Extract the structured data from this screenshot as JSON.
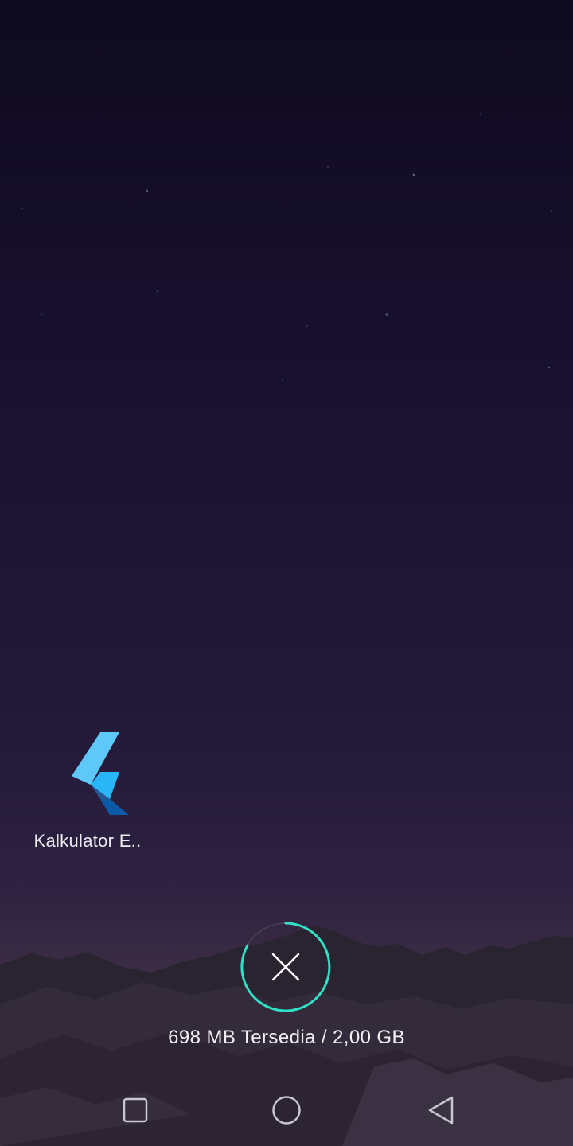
{
  "recent_apps": [
    {
      "label": "Kalkulator E..",
      "icon": "flutter-logo-icon"
    }
  ],
  "clear_all": {
    "icon": "close-icon",
    "accent": "#2fe0c4"
  },
  "memory": {
    "text": "698 MB Tersedia / 2,00 GB"
  },
  "navbar": {
    "recents_icon": "square-icon",
    "home_icon": "circle-icon",
    "back_icon": "triangle-back-icon"
  },
  "colors": {
    "flutter_light": "#5ec8f8",
    "flutter_mid": "#29b6f6",
    "flutter_dark": "#0a5aa8",
    "ring_accent": "#2fe0c4"
  }
}
